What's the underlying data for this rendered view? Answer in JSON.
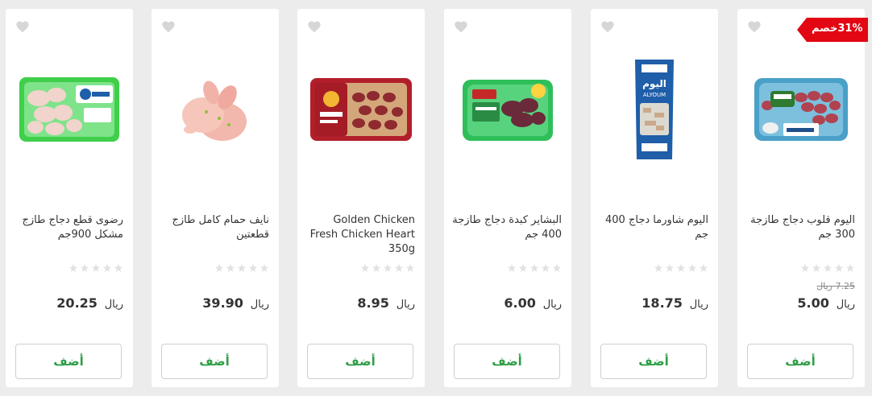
{
  "products": [
    {
      "title": "اليوم قلوب دجاج طازجة 300 جم",
      "discount_badge": "31%خصم",
      "old_price": "7.25 ريال",
      "price": "5.00",
      "currency": "ريال",
      "add_label": "أضف",
      "image_icon": "chicken-hearts-tray-icon"
    },
    {
      "title": "اليوم شاورما دجاج 400 جم",
      "price": "18.75",
      "currency": "ريال",
      "add_label": "أضف",
      "image_icon": "chicken-shawarma-pack-icon"
    },
    {
      "title": "البشاير كبدة دجاج طازجة 400 جم",
      "price": "6.00",
      "currency": "ريال",
      "add_label": "أضف",
      "image_icon": "chicken-liver-tray-icon"
    },
    {
      "title": "Golden Chicken Fresh Chicken Heart 350g",
      "price": "8.95",
      "currency": "ريال",
      "add_label": "أضف",
      "image_icon": "golden-chicken-heart-tray-icon"
    },
    {
      "title": "نايف حمام كامل طازج قطعتين",
      "price": "39.90",
      "currency": "ريال",
      "add_label": "أضف",
      "image_icon": "whole-pigeons-icon"
    },
    {
      "title": "رضوى قطع دجاج طازج مشكل 900جم",
      "price": "20.25",
      "currency": "ريال",
      "add_label": "أضف",
      "image_icon": "mixed-chicken-pieces-tray-icon"
    }
  ],
  "colors": {
    "accent_green": "#2e9e45",
    "badge_red": "#e30613",
    "star_gray": "#e2e2e2"
  }
}
